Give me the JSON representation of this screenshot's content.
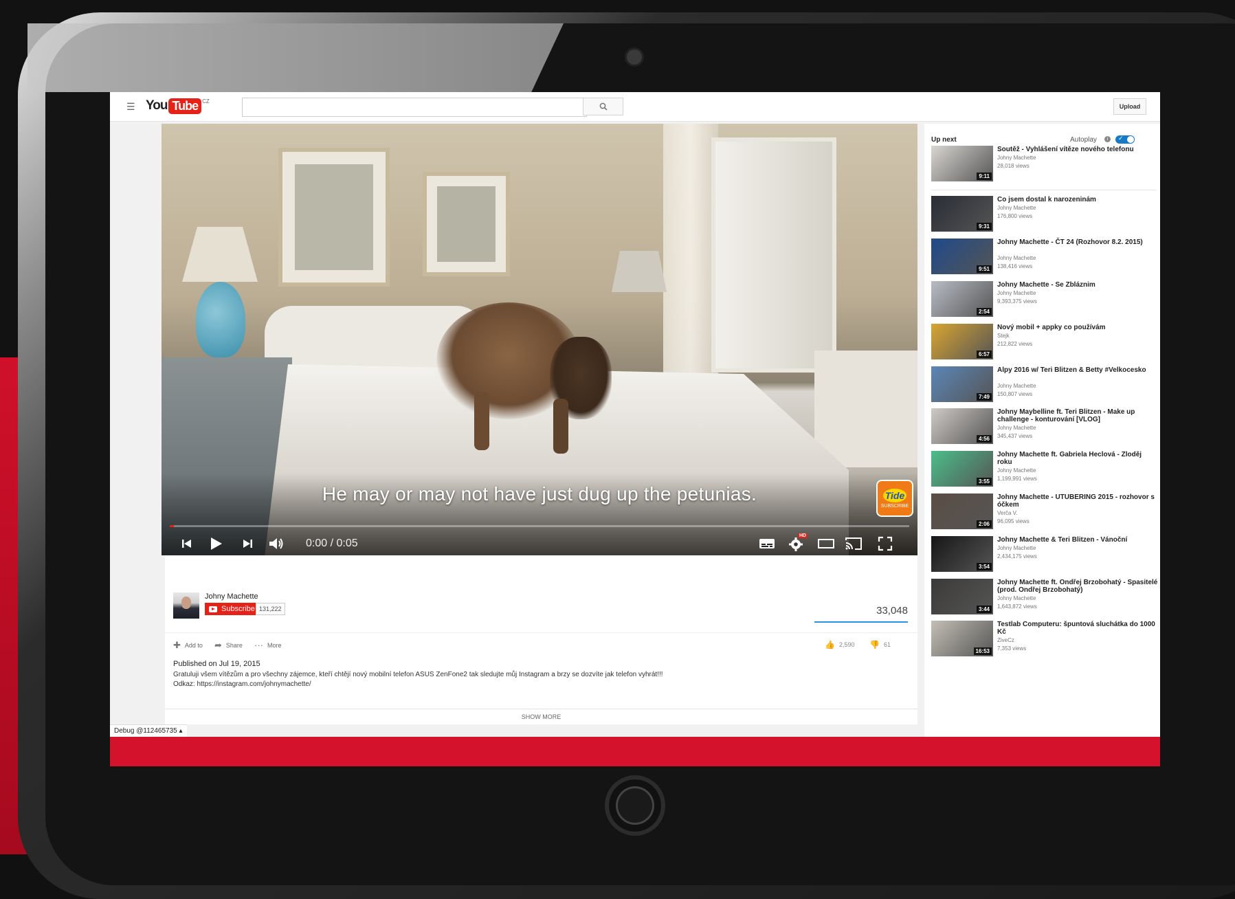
{
  "header": {
    "logo_you": "You",
    "logo_tube": "Tube",
    "logo_region": "CZ",
    "search_placeholder": "",
    "upload_label": "Upload"
  },
  "player": {
    "caption": "He may or may not have just dug up the petunias.",
    "brand_badge_top": "Tide",
    "brand_badge_bottom": "SUBSCRIBE",
    "time": "0:00 / 0:05",
    "progress": 0.006,
    "hd_badge": "HD"
  },
  "channel": {
    "name": "Johny Machette",
    "subscribe_label": "Subscribe",
    "subscriber_count": "131,222"
  },
  "stats": {
    "views": "33,048",
    "likes": "2,590",
    "dislikes": "61",
    "like_ratio": 0.977
  },
  "actions": {
    "add_to": "Add to",
    "share": "Share",
    "more": "More"
  },
  "description": {
    "published": "Published on Jul 19, 2015",
    "line1": "Gratuluji všem vítězům a pro všechny zájemce, kteří chtějí nový mobilní telefon ASUS ZenFone2 tak sledujte můj Instagram a brzy se dozvíte jak telefon vyhrát!!!",
    "line2": "Odkaz: https://instagram.com/johnymachette/",
    "show_more": "SHOW MORE"
  },
  "debug": "Debug @112465735",
  "sidebar": {
    "up_next": "Up next",
    "autoplay": "Autoplay",
    "items": [
      {
        "title": "Soutěž - Vyhlášení vítěze nového telefonu",
        "channel": "Johny Machette",
        "views": "28,018 views",
        "duration": "9:11",
        "thumb": "#d9d6d2"
      },
      {
        "title": "Co jsem dostal k narozeninám",
        "channel": "Johny Machette",
        "views": "176,800 views",
        "duration": "9:31",
        "thumb": "#2a2d36"
      },
      {
        "title": "Johny Machette - ČT 24 (Rozhovor 8.2. 2015)",
        "channel": "Johny Machette",
        "views": "138,416 views",
        "duration": "9:51",
        "thumb": "#1f4a8a"
      },
      {
        "title": "Johny Machette - Se Zbláznim",
        "channel": "Johny Machette",
        "views": "9,393,375 views",
        "duration": "2:54",
        "thumb": "#b8bcc4"
      },
      {
        "title": "Nový mobil + appky co používám",
        "channel": "Stejk",
        "views": "212,822 views",
        "duration": "6:57",
        "thumb": "#d9a531"
      },
      {
        "title": "Alpy 2016 w/ Teri Blitzen & Betty #Velkocesko",
        "channel": "Johny Machette",
        "views": "150,807 views",
        "duration": "7:49",
        "thumb": "#5c86b8"
      },
      {
        "title": "Johny Maybelline ft. Teri Blitzen - Make up challenge - konturování [VLOG]",
        "channel": "Johny Machette",
        "views": "345,437 views",
        "duration": "4:56",
        "thumb": "#cfcac6"
      },
      {
        "title": "Johny Machette ft. Gabriela Heclová - Zloděj roku",
        "channel": "Johny Machette",
        "views": "1,199,991 views",
        "duration": "3:55",
        "thumb": "#4bbf8a"
      },
      {
        "title": "Johny Machette - UTUBERING 2015 - rozhovor s óčkem",
        "channel": "Verča V.",
        "views": "96,095 views",
        "duration": "2:06",
        "thumb": "#5a4d44"
      },
      {
        "title": "Johny Machette & Teri Blitzen - Vánoční",
        "channel": "Johny Machette",
        "views": "2,434,175 views",
        "duration": "3:54",
        "thumb": "#161616"
      },
      {
        "title": "Johny Machette ft. Ondřej Brzobohatý - Spasitelé (prod. Ondřej Brzobohatý)",
        "channel": "Johny Machette",
        "views": "1,643,872 views",
        "duration": "3:44",
        "thumb": "#3b3a38"
      },
      {
        "title": "Testlab Computeru: špuntová sluchátka do 1000 Kč",
        "channel": "ZiveCz",
        "views": "7,353 views",
        "duration": "16:53",
        "thumb": "#c4bfb6"
      }
    ]
  }
}
